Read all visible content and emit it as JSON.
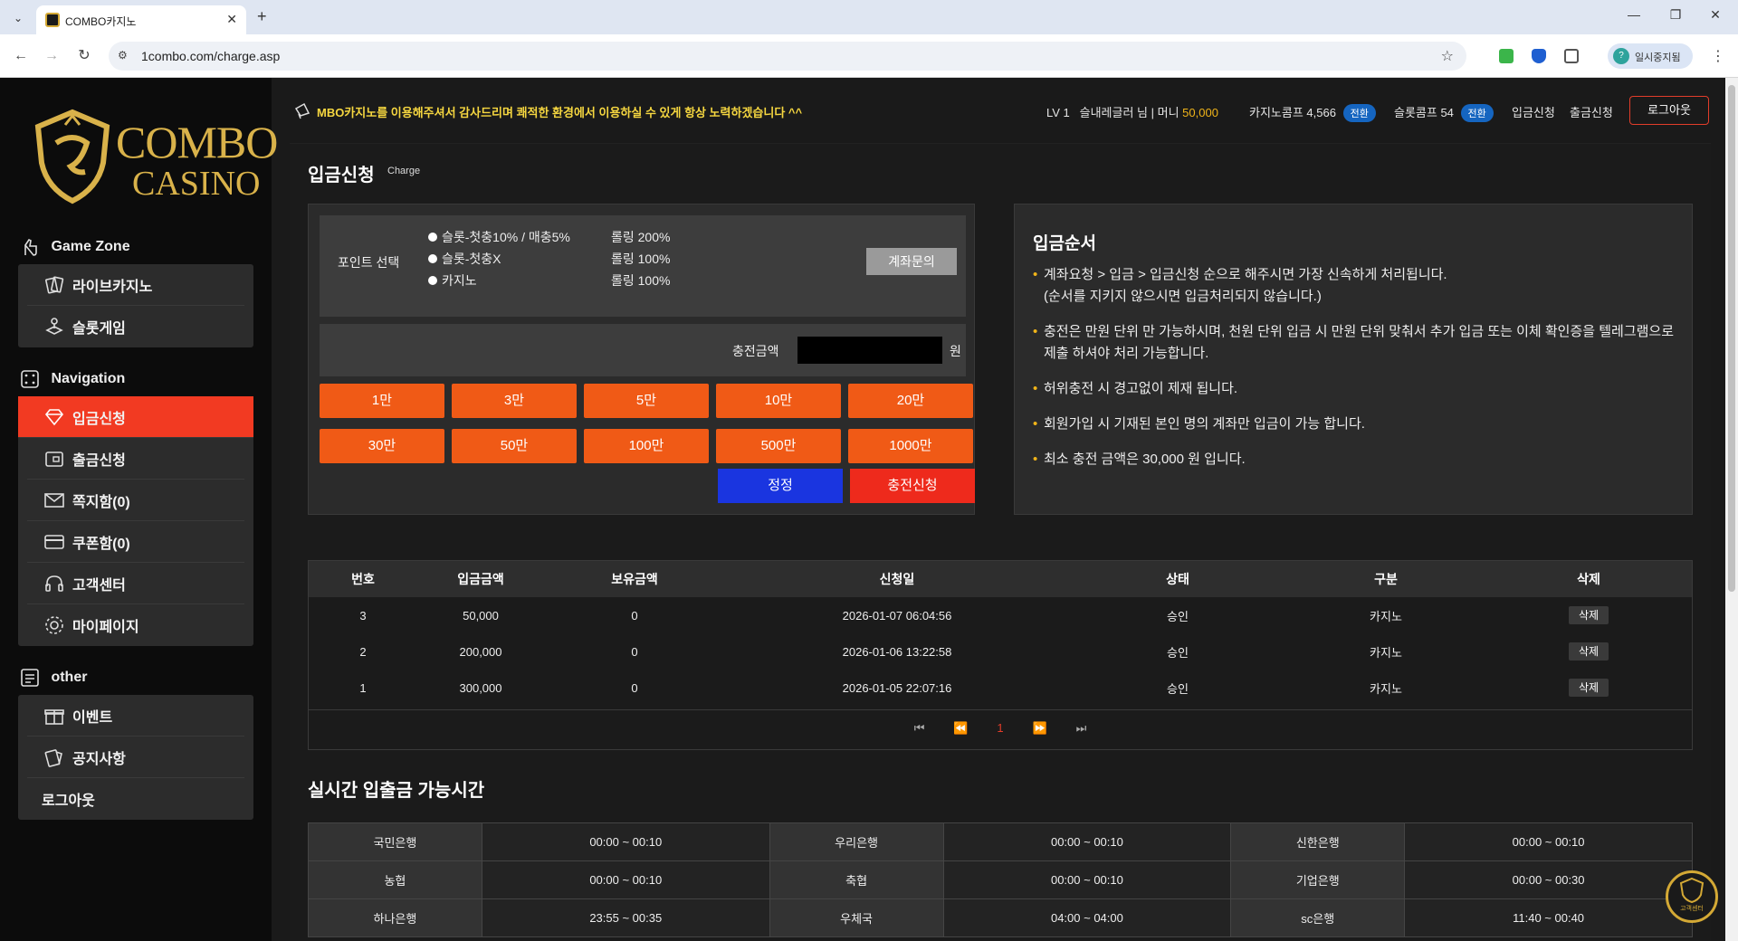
{
  "browser": {
    "tab_title": "COMBO카지노",
    "url": "1combo.com/charge.asp",
    "profile_label": "일시중지됨",
    "profile_initial": "?"
  },
  "marquee": "MBO카지노를 이용해주셔서 감사드리며 쾌적한 환경에서 이용하실 수 있게 항상 노력하겠습니다 ^^",
  "user": {
    "level": "LV 1",
    "name": "슬내레글러 님",
    "money_label": "머니",
    "money": "50,000",
    "casino_point_label": "카지노콤프 4,566",
    "slot_point_label": "슬롯콤프 54",
    "convert_label": "전환"
  },
  "top_links": {
    "deposit": "입금신청",
    "withdraw": "출금신청",
    "logout": "로그아웃"
  },
  "sidebar": {
    "logo_combo": "COMBO",
    "logo_casino": "CASINO",
    "game_zone_title": "Game Zone",
    "game_zone": [
      "라이브카지노",
      "슬롯게임"
    ],
    "navigation_title": "Navigation",
    "navigation": [
      "입금신청",
      "출금신청",
      "쪽지함(0)",
      "쿠폰함(0)",
      "고객센터",
      "마이페이지"
    ],
    "other_title": "other",
    "other": [
      "이벤트",
      "공지사항",
      "로그아웃"
    ]
  },
  "page": {
    "title": "입금신청",
    "subtitle": "Charge"
  },
  "form": {
    "point_label": "포인트 선택",
    "options": [
      {
        "label": "슬롯-첫충10% / 매충5%",
        "rolling": "롤링 200%"
      },
      {
        "label": "슬롯-첫충X",
        "rolling": "롤링 100%"
      },
      {
        "label": "카지노",
        "rolling": "롤링 100%"
      }
    ],
    "account_inquiry": "계좌문의",
    "amount_label": "충전금액",
    "amount_value": "",
    "amount_unit": "원",
    "quick_amounts": [
      "1만",
      "3만",
      "5만",
      "10만",
      "20만",
      "30만",
      "50만",
      "100만",
      "500만",
      "1000만"
    ],
    "reset": "정정",
    "submit": "충전신청"
  },
  "order": {
    "title": "입금순서",
    "items": [
      "계좌요청 > 입금 > 입금신청 순으로 해주시면 가장 신속하게 처리됩니다.\n(순서를 지키지 않으시면 입금처리되지 않습니다.)",
      "충전은 만원 단위 만 가능하시며, 천원 단위 입금 시 만원 단위 맞춰서 추가 입금 또는 이체 확인증을 텔레그램으로 제출 하셔야 처리 가능합니다.",
      "허위충전 시 경고없이 제재 됩니다.",
      "회원가입 시 기재된 본인 명의 계좌만 입금이 가능 합니다.",
      "최소 충전 금액은 30,000 원 입니다."
    ]
  },
  "history": {
    "headers": [
      "번호",
      "입금금액",
      "보유금액",
      "신청일",
      "상태",
      "구분",
      "삭제"
    ],
    "rows": [
      [
        "3",
        "50,000",
        "0",
        "2026-01-07 06:04:56",
        "승인",
        "카지노"
      ],
      [
        "2",
        "200,000",
        "0",
        "2026-01-06 13:22:58",
        "승인",
        "카지노"
      ],
      [
        "1",
        "300,000",
        "0",
        "2026-01-05 22:07:16",
        "승인",
        "카지노"
      ]
    ],
    "delete_label": "삭제",
    "current_page": "1"
  },
  "realtime": {
    "title": "실시간 입출금 가능시간",
    "rows": [
      [
        "국민은행",
        "00:00 ~ 00:10",
        "우리은행",
        "00:00 ~ 00:10",
        "신한은행",
        "00:00 ~ 00:10"
      ],
      [
        "농협",
        "00:00 ~ 00:10",
        "축협",
        "00:00 ~ 00:10",
        "기업은행",
        "00:00 ~ 00:30"
      ],
      [
        "하나은행",
        "23:55 ~ 00:35",
        "우체국",
        "04:00 ~ 04:00",
        "sc은행",
        "11:40 ~ 00:40"
      ]
    ]
  },
  "cs_badge": "고객센터",
  "colors": {
    "accent_orange": "#f05a16",
    "active_red": "#f23a22",
    "reset_blue": "#1a35e0",
    "gold": "#d9b24a",
    "marquee_yellow": "#f6d740"
  }
}
